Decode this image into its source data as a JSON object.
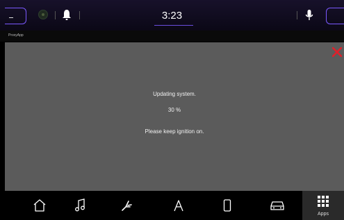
{
  "status_bar": {
    "time": "3:23",
    "left_indicator": "--",
    "icons": [
      "camera-dot-icon",
      "bell-icon",
      "microphone-icon"
    ]
  },
  "app": {
    "title": "ProxyApp"
  },
  "update": {
    "status_line": "Updating system.",
    "progress_text": "30 %",
    "instruction": "Please keep ignition on."
  },
  "dock": {
    "items": [
      "home-icon",
      "music-icon",
      "seat-icon",
      "navigation-icon",
      "phone-icon",
      "car-icon"
    ],
    "apps_label": "Apps"
  },
  "colors": {
    "accent_purple": "#7b59ff",
    "close_red": "#e0202a",
    "panel_gray": "#5b5b5b"
  }
}
